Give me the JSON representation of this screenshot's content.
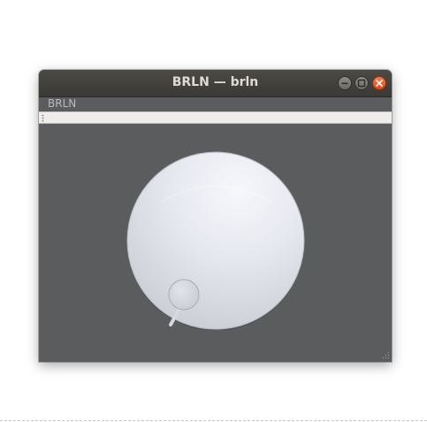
{
  "window": {
    "title": "BRLN — brln",
    "controls": [
      "minimize-icon",
      "maximize-icon",
      "close-icon"
    ]
  },
  "app": {
    "name": "BRLN"
  },
  "knob": {
    "value_fraction": 0.0,
    "colors": {
      "face": "#e6e8ee",
      "indicator": "#d2d5db"
    }
  },
  "colors": {
    "background": "#5b5c5e",
    "titlebar": "#3c3b37",
    "close": "#e9541f"
  }
}
